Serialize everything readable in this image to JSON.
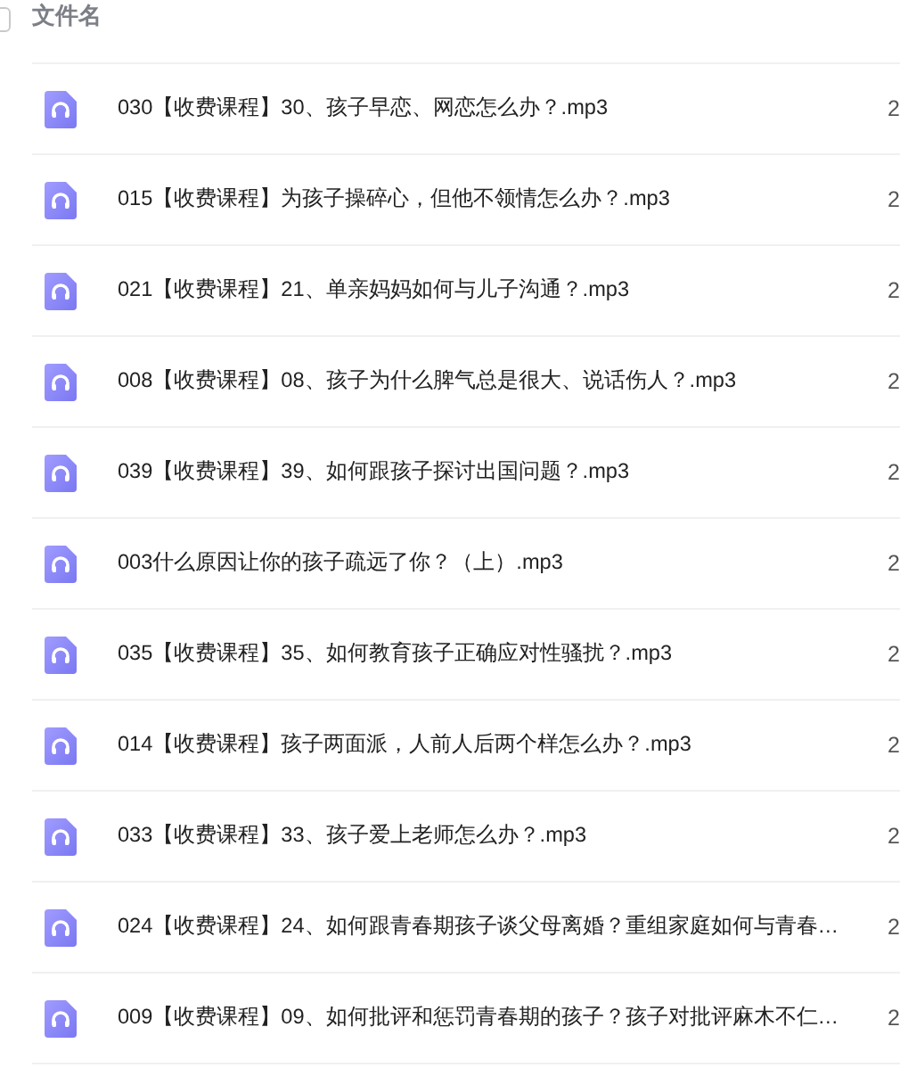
{
  "header": {
    "select_all": {
      "checked": false
    },
    "column_name": "文件名"
  },
  "files": [
    {
      "name": "030【收费课程】30、孩子早恋、网恋怎么办？.mp3",
      "column_2": "2"
    },
    {
      "name": "015【收费课程】为孩子操碎心，但他不领情怎么办？.mp3",
      "column_2": "2"
    },
    {
      "name": "021【收费课程】21、单亲妈妈如何与儿子沟通？.mp3",
      "column_2": "2"
    },
    {
      "name": "008【收费课程】08、孩子为什么脾气总是很大、说话伤人？.mp3",
      "column_2": "2"
    },
    {
      "name": "039【收费课程】39、如何跟孩子探讨出国问题？.mp3",
      "column_2": "2"
    },
    {
      "name": "003什么原因让你的孩子疏远了你？（上）.mp3",
      "column_2": "2"
    },
    {
      "name": "035【收费课程】35、如何教育孩子正确应对性骚扰？.mp3",
      "column_2": "2"
    },
    {
      "name": "014【收费课程】孩子两面派，人前人后两个样怎么办？.mp3",
      "column_2": "2"
    },
    {
      "name": "033【收费课程】33、孩子爱上老师怎么办？.mp3",
      "column_2": "2"
    },
    {
      "name": "024【收费课程】24、如何跟青春期孩子谈父母离婚？重组家庭如何与青春…",
      "column_2": "2"
    },
    {
      "name": "009【收费课程】09、如何批评和惩罚青春期的孩子？孩子对批评麻木不仁…",
      "column_2": "2"
    }
  ]
}
